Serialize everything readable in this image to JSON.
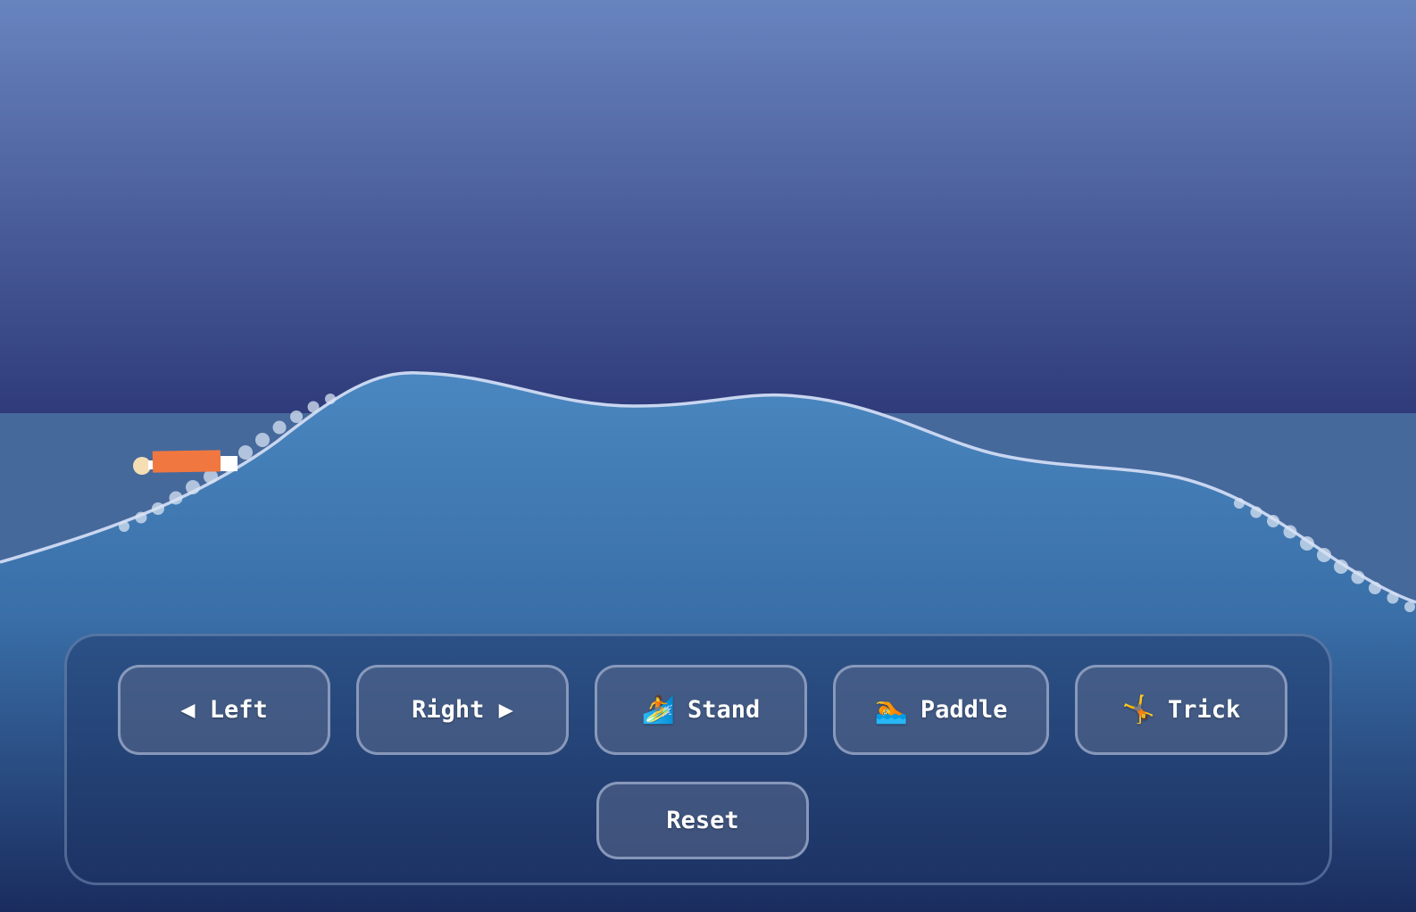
{
  "controls": {
    "left_label": "◀ Left",
    "right_label": "Right ▶",
    "stand_icon": "🏄",
    "stand_label": "Stand",
    "paddle_icon": "🏊",
    "paddle_label": "Paddle",
    "trick_icon": "🤸",
    "trick_label": "Trick",
    "reset_label": "Reset"
  },
  "colors": {
    "sky_top": "#6884bf",
    "sky_bottom": "#2f3b7a",
    "water_top": "#4a87c0",
    "water_bottom": "#1a2c5e",
    "wave_line": "#c9d6f0",
    "foam": "#d7e3f3",
    "surfer_body": "#f07840",
    "surfer_head": "#f5deb3"
  },
  "surfer": {
    "posture": "paddling"
  }
}
